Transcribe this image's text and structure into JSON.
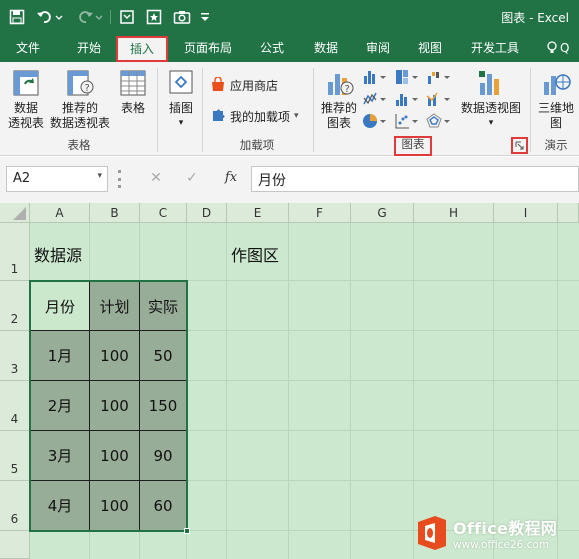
{
  "app": {
    "title": "图表 - Excel"
  },
  "tabs": [
    {
      "label": "文件"
    },
    {
      "label": "开始"
    },
    {
      "label": "插入"
    },
    {
      "label": "页面布局"
    },
    {
      "label": "公式"
    },
    {
      "label": "数据"
    },
    {
      "label": "审阅"
    },
    {
      "label": "视图"
    },
    {
      "label": "开发工具"
    },
    {
      "label": "Q"
    }
  ],
  "active_tab": "插入",
  "ribbon": {
    "table_group": {
      "name": "表格",
      "pivot": [
        "数据",
        "透视表"
      ],
      "recommended_pivot": [
        "推荐的",
        "数据透视表"
      ],
      "table": "表格"
    },
    "illustrations": {
      "label": "插图"
    },
    "addins_group": {
      "name": "加载项",
      "store": "应用商店",
      "my_addins": "我的加载项"
    },
    "charts_group": {
      "name": "图表",
      "recommended_charts": [
        "推荐的",
        "图表"
      ],
      "pivot_chart": "数据透视图"
    },
    "tours_group": {
      "name": "演示",
      "map": [
        "三维地",
        "图"
      ]
    }
  },
  "formula_bar": {
    "name_box": "A2",
    "fx": "fx",
    "formula": "月份"
  },
  "columns": [
    "A",
    "B",
    "C",
    "D",
    "E",
    "F",
    "G",
    "H",
    "I"
  ],
  "rows": [
    "1",
    "2",
    "3",
    "4",
    "5",
    "6"
  ],
  "sheet": {
    "source_label": "数据源",
    "chart_area_label": "作图区",
    "table_header": [
      "月份",
      "计划",
      "实际"
    ],
    "table_rows": [
      [
        "1月",
        "100",
        "50"
      ],
      [
        "2月",
        "100",
        "150"
      ],
      [
        "3月",
        "100",
        "90"
      ],
      [
        "4月",
        "100",
        "60"
      ]
    ]
  },
  "watermark": {
    "brand": "Office教程网",
    "url": "www.office26.com"
  },
  "colors": {
    "excel_green": "#217346",
    "highlight_red": "#e03b3b",
    "sheet_bg": "#cce8cf"
  }
}
